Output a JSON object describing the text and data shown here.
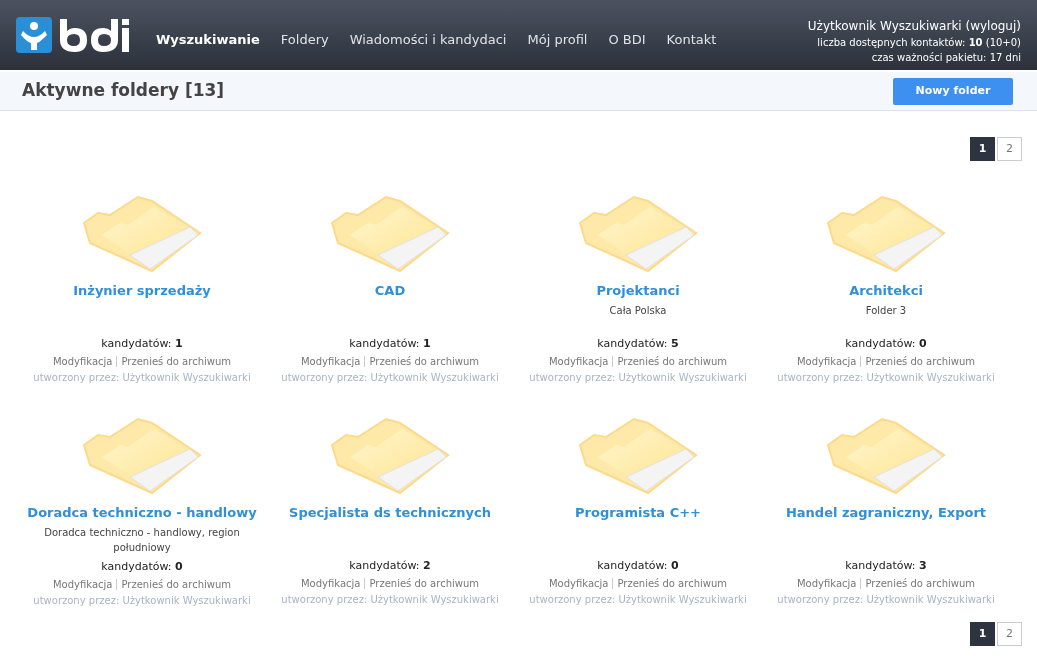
{
  "header": {
    "nav": [
      {
        "label": "Wyszukiwanie",
        "selected": true
      },
      {
        "label": "Foldery",
        "selected": false
      },
      {
        "label": "Wiadomości i kandydaci",
        "selected": false
      },
      {
        "label": "Mój profil",
        "selected": false
      },
      {
        "label": "O BDI",
        "selected": false
      },
      {
        "label": "Kontakt",
        "selected": false
      }
    ],
    "user": "Użytkownik Wyszukiwarki (wyloguj)",
    "contacts": "liczba dostępnych kontaktów: **10** (10+0)",
    "expiry": "czas ważności pakietu: 17 dni"
  },
  "title": "Aktywne foldery [13]",
  "new_button": "Nowy folder",
  "pagination_top": [
    {
      "label": "1",
      "selected": true
    },
    {
      "label": "2",
      "selected": false
    }
  ],
  "folders": [
    {
      "title": "Inżynier sprzedaży",
      "count": "kandydatów: **1**",
      "actions": [
        "Modyfikacja",
        "Przenieś do archiwum"
      ],
      "creator": "utworzony przez: Użytkownik Wyszukiwarki"
    },
    {
      "title": "CAD",
      "count": "kandydatów: **1**",
      "actions": [
        "Modyfikacja",
        "Przenieś do archiwum"
      ],
      "creator": "utworzony przez: Użytkownik Wyszukiwarki"
    },
    {
      "title": "Projektanci",
      "description": "Cała Polska",
      "count": "kandydatów: **5**",
      "actions": [
        "Modyfikacja",
        "Przenieś do archiwum"
      ],
      "creator": "utworzony przez: Użytkownik Wyszukiwarki"
    },
    {
      "title": "Architekci",
      "description": "Folder 3",
      "count": "kandydatów: **0**",
      "actions": [
        "Modyfikacja",
        "Przenieś do archiwum"
      ],
      "creator": "utworzony przez: Użytkownik Wyszukiwarki"
    },
    {
      "title": "Doradca techniczno - handlowy",
      "description": "Doradca techniczno - handlowy, region południowy",
      "count": "kandydatów: **0**",
      "actions": [
        "Modyfikacja",
        "Przenieś do archiwum"
      ],
      "creator": "utworzony przez: Użytkownik Wyszukiwarki"
    },
    {
      "title": "Specjalista ds technicznych",
      "count": "kandydatów: **2**",
      "actions": [
        "Modyfikacja",
        "Przenieś do archiwum"
      ],
      "creator": "utworzony przez: Użytkownik Wyszukiwarki"
    },
    {
      "title": "Programista C++",
      "count": "kandydatów: **0**",
      "actions": [
        "Modyfikacja",
        "Przenieś do archiwum"
      ],
      "creator": "utworzony przez: Użytkownik Wyszukiwarki"
    },
    {
      "title": "Handel zagraniczny, Export",
      "count": "kandydatów: **3**",
      "actions": [
        "Modyfikacja",
        "Przenieś do archiwum"
      ],
      "creator": "utworzony przez: Użytkownik Wyszukiwarki"
    }
  ],
  "pagination_bottom": [
    {
      "label": "1",
      "selected": true
    },
    {
      "label": "2",
      "selected": false
    }
  ]
}
